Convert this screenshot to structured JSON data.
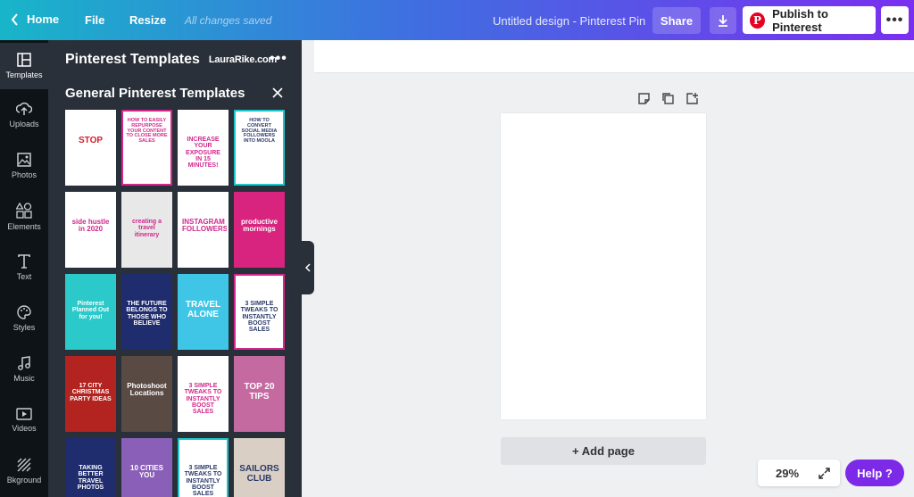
{
  "topbar": {
    "home_label": "Home",
    "file_label": "File",
    "resize_label": "Resize",
    "save_status": "All changes saved",
    "document_title": "Untitled design - Pinterest Pin",
    "share_label": "Share",
    "download_icon": "download-icon",
    "publish_label": "Publish to Pinterest",
    "pinterest_logo_letter": "P",
    "more_label": "•••",
    "gradient_colors": [
      "#18b5c9",
      "#3f6fe0",
      "#7a2ff0"
    ]
  },
  "rail": {
    "items": [
      {
        "label": "Templates",
        "icon": "templates-icon",
        "active": true
      },
      {
        "label": "Uploads",
        "icon": "upload-cloud-icon"
      },
      {
        "label": "Photos",
        "icon": "photo-icon"
      },
      {
        "label": "Elements",
        "icon": "elements-icon"
      },
      {
        "label": "Text",
        "icon": "text-icon"
      },
      {
        "label": "Styles",
        "icon": "palette-icon"
      },
      {
        "label": "Music",
        "icon": "music-icon"
      },
      {
        "label": "Videos",
        "icon": "video-icon"
      },
      {
        "label": "Bkground",
        "icon": "background-icon"
      }
    ]
  },
  "panel": {
    "title": "Pinterest Templates",
    "site": "LauraRike.com",
    "more_label": "•••",
    "section_title": "General Pinterest Templates",
    "templates": [
      {
        "text": "STOP",
        "bg": "#ffffff",
        "fg": "#d11f2a",
        "border": "transparent"
      },
      {
        "text": "HOW TO EASILY REPURPOSE YOUR CONTENT TO CLOSE MORE SALES",
        "bg": "#ffffff",
        "fg": "#d2288c",
        "border": "#d2288c"
      },
      {
        "text": "INCREASE YOUR EXPOSURE IN 15 MINUTES!",
        "bg": "#ffffff",
        "fg": "#d2288c",
        "border": "transparent"
      },
      {
        "text": "HOW TO CONVERT SOCIAL MEDIA FOLLOWERS INTO MOOLA",
        "bg": "#ffffff",
        "fg": "#2a3a6a",
        "border": "#1fc6c9"
      },
      {
        "text": "side hustle in 2020",
        "bg": "#ffffff",
        "fg": "#d2288c",
        "border": "transparent"
      },
      {
        "text": "creating a travel itinerary",
        "bg": "#e8e8e8",
        "fg": "#d2288c",
        "border": "transparent"
      },
      {
        "text": "INSTAGRAM FOLLOWERS",
        "bg": "#ffffff",
        "fg": "#d2288c",
        "border": "transparent"
      },
      {
        "text": "productive mornings",
        "bg": "#d8247f",
        "fg": "#ffffff",
        "border": "transparent"
      },
      {
        "text": "Pinterest Planned Out for you!",
        "bg": "#2bc9c9",
        "fg": "#ffffff",
        "border": "transparent"
      },
      {
        "text": "THE FUTURE BELONGS TO THOSE WHO BELIEVE",
        "bg": "#1f2c6e",
        "fg": "#ffffff",
        "border": "transparent"
      },
      {
        "text": "TRAVEL ALONE",
        "bg": "#3fc6e6",
        "fg": "#ffffff",
        "border": "transparent"
      },
      {
        "text": "3 SIMPLE TWEAKS TO INSTANTLY BOOST SALES",
        "bg": "#ffffff",
        "fg": "#2a3a6a",
        "border": "#d2288c"
      },
      {
        "text": "17 CITY CHRISTMAS PARTY IDEAS",
        "bg": "#b3231f",
        "fg": "#ffffff",
        "border": "transparent"
      },
      {
        "text": "Photoshoot Locations",
        "bg": "#5a4a44",
        "fg": "#ffffff",
        "border": "transparent"
      },
      {
        "text": "3 SIMPLE TWEAKS TO INSTANTLY BOOST SALES",
        "bg": "#ffffff",
        "fg": "#d2288c",
        "border": "transparent"
      },
      {
        "text": "TOP 20 TIPS",
        "bg": "#c46aa0",
        "fg": "#ffffff",
        "border": "transparent"
      },
      {
        "text": "TAKING BETTER TRAVEL PHOTOS",
        "bg": "#1f2c6e",
        "fg": "#ffffff",
        "border": "transparent"
      },
      {
        "text": "10 CITIES YOU",
        "bg": "#8a5fb8",
        "fg": "#ffffff",
        "border": "transparent"
      },
      {
        "text": "3 SIMPLE TWEAKS TO INSTANTLY BOOST SALES",
        "bg": "#ffffff",
        "fg": "#2a3a6a",
        "border": "#1fc6c9"
      },
      {
        "text": "SAILORS CLUB",
        "bg": "#d9cfc4",
        "fg": "#2a3a6a",
        "border": "transparent"
      }
    ]
  },
  "canvas": {
    "add_page_label": "+ Add page",
    "zoom_label": "29%",
    "help_label": "Help  ?",
    "tools": [
      "notes-icon",
      "duplicate-icon",
      "add-page-icon"
    ]
  }
}
